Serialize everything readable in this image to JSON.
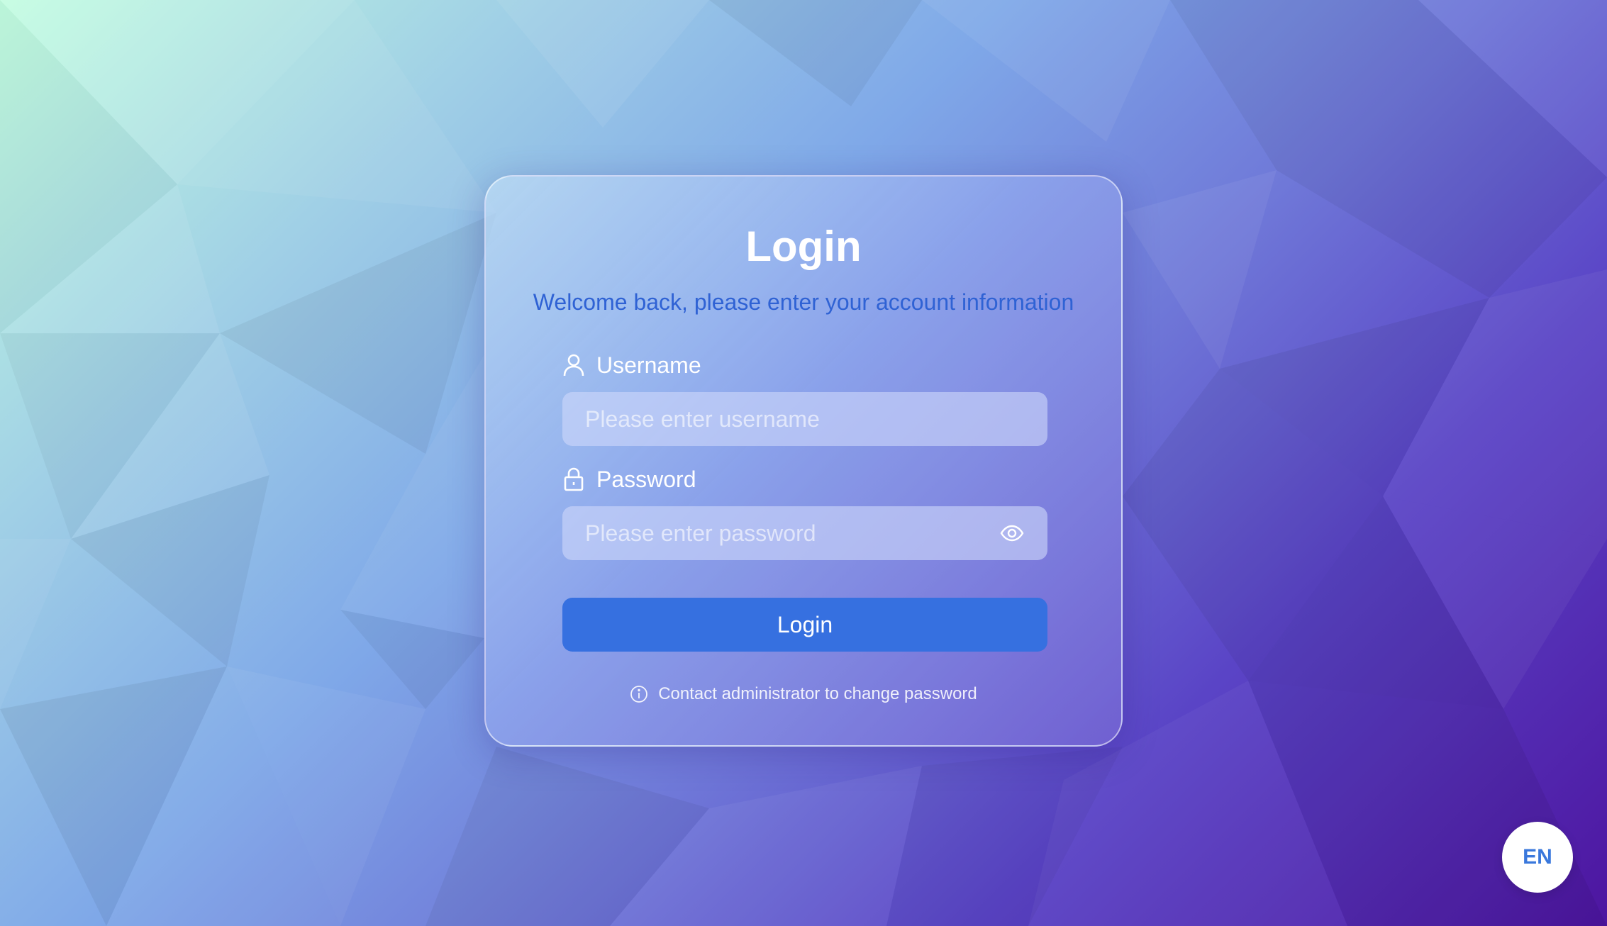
{
  "login": {
    "title": "Login",
    "subtitle": "Welcome back, please enter your account information",
    "username_label": "Username",
    "username_placeholder": "Please enter username",
    "password_label": "Password",
    "password_placeholder": "Please enter password",
    "submit_label": "Login",
    "hint": "Contact administrator to change password"
  },
  "language": {
    "current": "EN"
  },
  "icons": {
    "username": "user-icon",
    "password": "lock-icon",
    "toggle_visibility": "eye-icon",
    "hint": "info-icon"
  },
  "colors": {
    "accent": "#3670e0",
    "subtitle": "#2f62d4"
  }
}
